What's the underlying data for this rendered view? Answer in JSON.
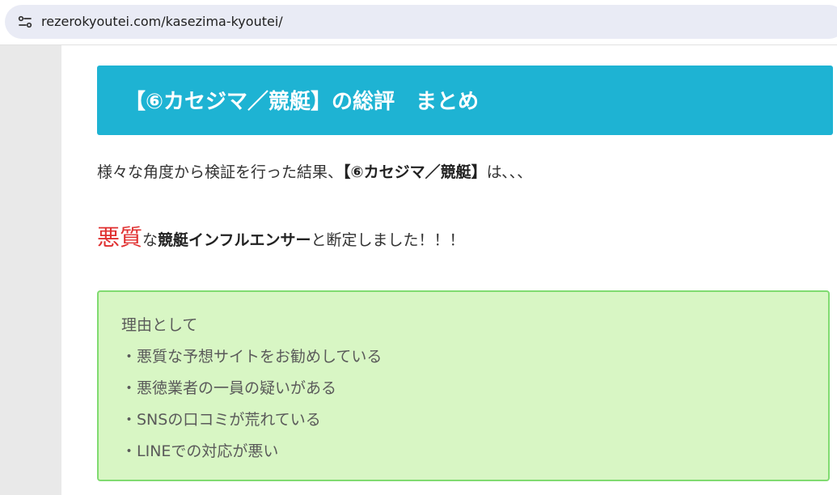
{
  "browser": {
    "url": "rezerokyoutei.com/kasezima-kyoutei/",
    "site_info_icon": "tune-icon"
  },
  "article": {
    "heading": "【⑥カセジマ／競艇】の総評　まとめ",
    "para1": {
      "prefix": "様々な角度から検証を行った結果、",
      "bold": "【⑥カセジマ／競艇】",
      "suffix": "は､､､"
    },
    "para2": {
      "red": "悪質",
      "connector": "な",
      "bold": "競艇インフルエンサー",
      "suffix": "と断定しました！！！"
    },
    "reasons": {
      "intro": "理由として",
      "items": [
        "・悪質な予想サイトをお勧めしている",
        "・悪徳業者の一員の疑いがある",
        "・SNSの口コミが荒れている",
        "・LINEでの対応が悪い"
      ]
    }
  },
  "colors": {
    "heading_bg": "#1eb3d3",
    "reason_bg": "#d8f6c4",
    "reason_border": "#80db70",
    "accent_red": "#e03030"
  }
}
